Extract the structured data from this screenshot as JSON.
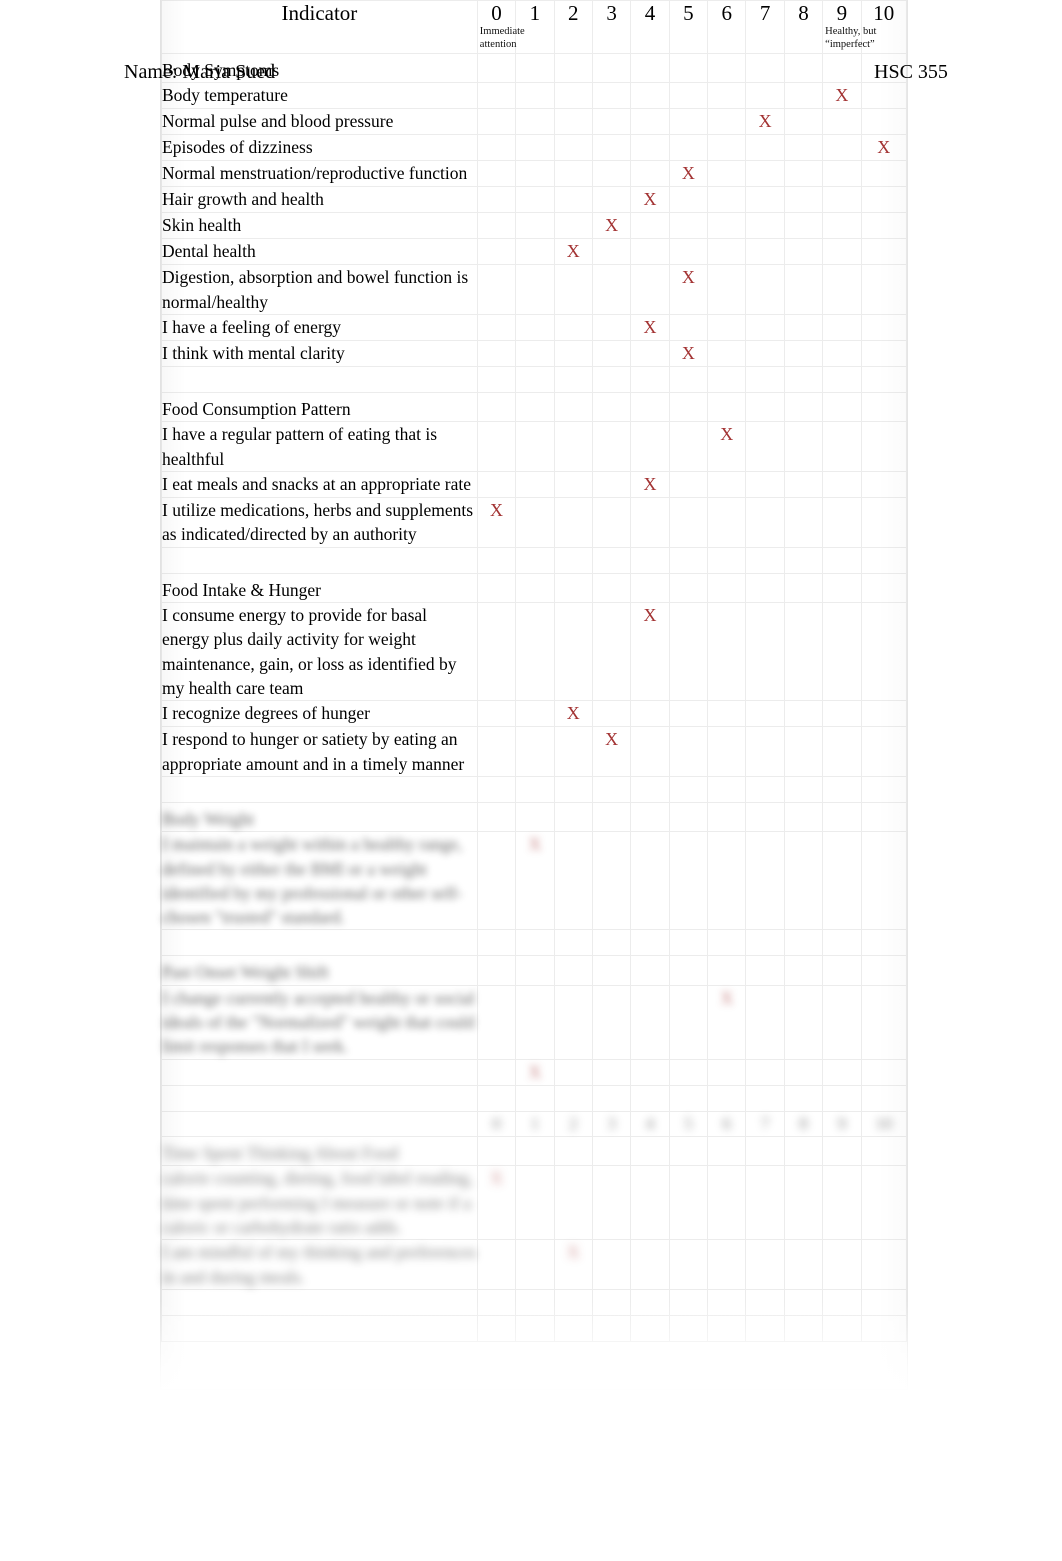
{
  "page": {
    "name_label": "Name:",
    "student_name": "Maria Sued",
    "course_code": "HSC 355"
  },
  "table": {
    "indicator_header": "Indicator",
    "scale": [
      "0",
      "1",
      "2",
      "3",
      "4",
      "5",
      "6",
      "7",
      "8",
      "9",
      "10"
    ],
    "anchor_low_line1": "Immediate",
    "anchor_low_line2": "attention",
    "anchor_high_line1": "Healthy, but",
    "anchor_high_line2": "“imperfect”",
    "mark_glyph": "X",
    "mark_color": "#a33333",
    "sections": [
      {
        "title": "Body Symptoms",
        "rows": [
          {
            "label": "Body temperature",
            "rating": 9
          },
          {
            "label": "Normal pulse and blood pressure",
            "rating": 7
          },
          {
            "label": "Episodes of dizziness",
            "rating": 10
          },
          {
            "label": "Normal menstruation/reproductive function",
            "rating": 5
          },
          {
            "label": "Hair growth and health",
            "rating": 4
          },
          {
            "label": "Skin health",
            "rating": 3
          },
          {
            "label": "Dental health",
            "rating": 2
          },
          {
            "label": "Digestion, absorption and bowel function is normal/healthy",
            "rating": 5
          },
          {
            "label": "I have a feeling of energy",
            "rating": 4
          },
          {
            "label": "I think with mental clarity",
            "rating": 5
          }
        ]
      },
      {
        "title": "Food Consumption Pattern",
        "rows": [
          {
            "label": "I have a regular pattern of eating that is healthful",
            "rating": 6
          },
          {
            "label": "I eat meals and snacks at an appropriate rate",
            "rating": 4
          },
          {
            "label": "I utilize medications, herbs and supplements as indicated/directed by an authority",
            "rating": 0
          }
        ]
      },
      {
        "title": "Food Intake & Hunger",
        "rows": [
          {
            "label": "I consume energy to provide for basal energy plus daily activity for weight maintenance, gain, or loss as identified by my health care team",
            "rating": 4
          },
          {
            "label": "I recognize degrees of hunger",
            "rating": 2
          },
          {
            "label": "I respond to hunger or satiety by eating an appropriate amount and in a timely manner",
            "rating": 3
          }
        ]
      },
      {
        "title": "Body Weight",
        "redacted": true,
        "rows": [
          {
            "label": "I maintain a weight within a healthy range, defined by either the BMI or a weight identified by my professional or other self-chosen \"trusted\" standard.",
            "rating": 1
          }
        ]
      },
      {
        "title": "Past Onset Weight Shift",
        "redacted": true,
        "rows": [
          {
            "label": "I change currently accepted healthy or social ideals of the \"Normalized\" weight that could limit responses that I seek.",
            "rating": 6
          },
          {
            "label": "",
            "rating": 1
          }
        ]
      },
      {
        "title": "Time Spent Thinking About Food",
        "redacted": true,
        "rows": [
          {
            "label": "calorie counting, dieting, food label reading, time spent performing I measure or note if a caloric or carbohydrate ratio adds.",
            "rating": 0
          },
          {
            "label": "I am mindful of my thinking and preferences in and during meals.",
            "rating": 2
          }
        ]
      }
    ]
  }
}
